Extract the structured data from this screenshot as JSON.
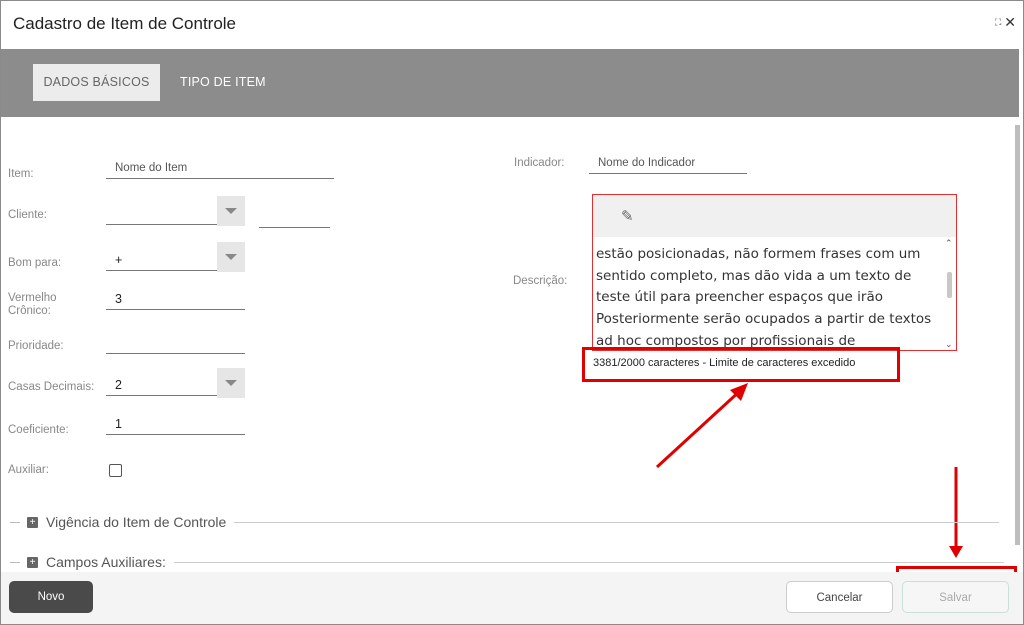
{
  "window": {
    "title": "Cadastro de Item de Controle",
    "maximize_icon": "maximize-icon",
    "close_icon": "close-icon"
  },
  "tabs": [
    {
      "label": "DADOS BÁSICOS",
      "active": true
    },
    {
      "label": "TIPO DE ITEM",
      "active": false
    }
  ],
  "form": {
    "item": {
      "label": "Item:",
      "placeholder": "Nome do Item"
    },
    "cliente": {
      "label": "Cliente:",
      "value": "",
      "extra_value": ""
    },
    "bom_para": {
      "label": "Bom para:",
      "value": "+"
    },
    "vermelho_cronico": {
      "label_line1": "Vermelho",
      "label_line2": "Crônico:",
      "value": "3"
    },
    "prioridade": {
      "label": "Prioridade:",
      "value": ""
    },
    "casas_decimais": {
      "label": "Casas Decimais:",
      "value": "2"
    },
    "coeficiente": {
      "label": "Coeficiente:",
      "value": "1"
    },
    "auxiliar": {
      "label": "Auxiliar:",
      "checked": false
    },
    "indicador": {
      "label": "Indicador:",
      "placeholder": "Nome do Indicador"
    },
    "descricao": {
      "label": "Descrição:",
      "text_lines": [
        "estão posicionadas, não formem frases com um",
        "sentido completo, mas dão vida a um texto de",
        "teste útil para preencher espaços que irão",
        "Posteriormente serão ocupados a partir de textos",
        "ad hoc compostos por profissionais de"
      ],
      "counter": "3381/2000 caracteres - Limite de caracteres excedido"
    }
  },
  "sections": [
    {
      "label": "Vigência do Item de Controle"
    },
    {
      "label": "Campos Auxiliares:"
    }
  ],
  "footer": {
    "novo_label": "Novo",
    "cancel_label": "Cancelar",
    "save_label": "Salvar"
  },
  "colors": {
    "tabbar": "#8c8c8c",
    "annotation_red": "#e00000",
    "novo_button": "#4a4a4a"
  }
}
